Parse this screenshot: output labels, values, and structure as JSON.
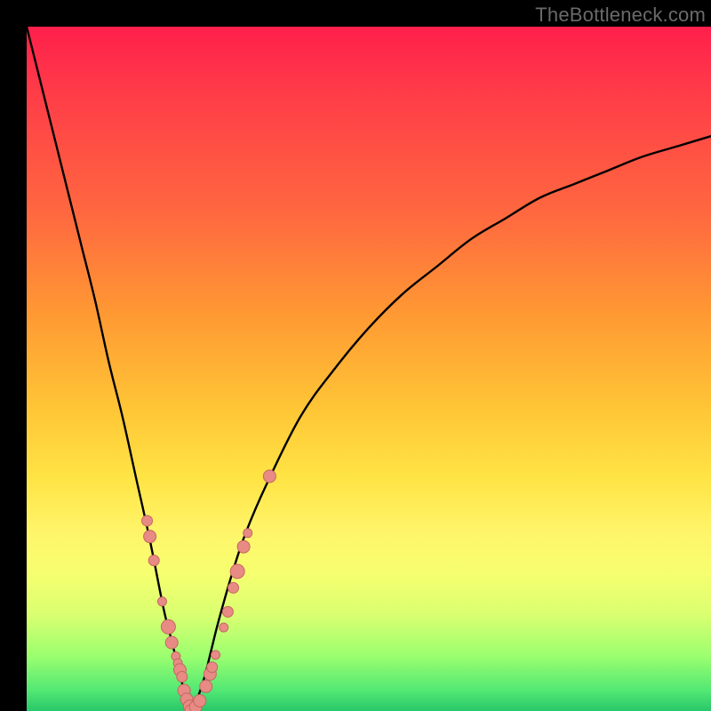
{
  "watermark": "TheBottleneck.com",
  "colors": {
    "frame": "#000000",
    "curve": "#000000",
    "dot_fill": "#e98b85",
    "dot_stroke": "#c46762",
    "gradient_stops": [
      "#ff1f4b",
      "#ff3d48",
      "#ff6a3f",
      "#ff9933",
      "#ffc636",
      "#ffe445",
      "#fff56a",
      "#f6ff6f",
      "#d9ff70",
      "#9bff6f",
      "#52e874",
      "#28c76a"
    ]
  },
  "chart_data": {
    "type": "line",
    "title": "",
    "xlabel": "",
    "ylabel": "",
    "xlim": [
      0,
      100
    ],
    "ylim": [
      0,
      100
    ],
    "note": "V-shaped bottleneck curve; y ≈ 0 near x ≈ 24, rising toward both ends. Values estimated from pixels.",
    "series": [
      {
        "name": "bottleneck-curve",
        "x": [
          0,
          2,
          4,
          6,
          8,
          10,
          12,
          14,
          16,
          18,
          20,
          21,
          22,
          23,
          24,
          25,
          26,
          27,
          28,
          30,
          32,
          35,
          40,
          45,
          50,
          55,
          60,
          65,
          70,
          75,
          80,
          85,
          90,
          95,
          100
        ],
        "y": [
          100,
          92,
          84,
          76,
          68,
          60,
          51,
          43,
          34,
          25,
          15,
          11,
          7,
          3,
          0,
          2,
          5,
          9,
          13,
          20,
          26,
          33,
          43,
          50,
          56,
          61,
          65,
          69,
          72,
          75,
          77,
          79,
          81,
          82.5,
          84
        ]
      }
    ],
    "scatter": {
      "name": "highlighted-points",
      "points": [
        {
          "x": 17.6,
          "y": 27.8,
          "r": 6
        },
        {
          "x": 18.0,
          "y": 25.5,
          "r": 7
        },
        {
          "x": 18.6,
          "y": 22.0,
          "r": 6
        },
        {
          "x": 19.8,
          "y": 16.0,
          "r": 5
        },
        {
          "x": 20.7,
          "y": 12.3,
          "r": 8
        },
        {
          "x": 21.2,
          "y": 10.0,
          "r": 7
        },
        {
          "x": 21.8,
          "y": 8.0,
          "r": 5
        },
        {
          "x": 22.1,
          "y": 7.0,
          "r": 5
        },
        {
          "x": 22.4,
          "y": 6.0,
          "r": 7
        },
        {
          "x": 22.7,
          "y": 5.0,
          "r": 6
        },
        {
          "x": 23.0,
          "y": 3.0,
          "r": 7
        },
        {
          "x": 23.4,
          "y": 1.7,
          "r": 7
        },
        {
          "x": 23.8,
          "y": 0.7,
          "r": 7
        },
        {
          "x": 24.0,
          "y": 0.0,
          "r": 7
        },
        {
          "x": 24.7,
          "y": 0.6,
          "r": 7
        },
        {
          "x": 25.3,
          "y": 1.5,
          "r": 7
        },
        {
          "x": 26.2,
          "y": 3.6,
          "r": 7
        },
        {
          "x": 26.8,
          "y": 5.4,
          "r": 7
        },
        {
          "x": 27.1,
          "y": 6.4,
          "r": 6
        },
        {
          "x": 27.6,
          "y": 8.2,
          "r": 5
        },
        {
          "x": 28.8,
          "y": 12.2,
          "r": 5
        },
        {
          "x": 29.4,
          "y": 14.5,
          "r": 6
        },
        {
          "x": 30.2,
          "y": 18.0,
          "r": 6
        },
        {
          "x": 30.8,
          "y": 20.4,
          "r": 8
        },
        {
          "x": 31.7,
          "y": 24.0,
          "r": 7
        },
        {
          "x": 32.3,
          "y": 26.0,
          "r": 5
        },
        {
          "x": 35.5,
          "y": 34.3,
          "r": 7
        }
      ]
    }
  }
}
